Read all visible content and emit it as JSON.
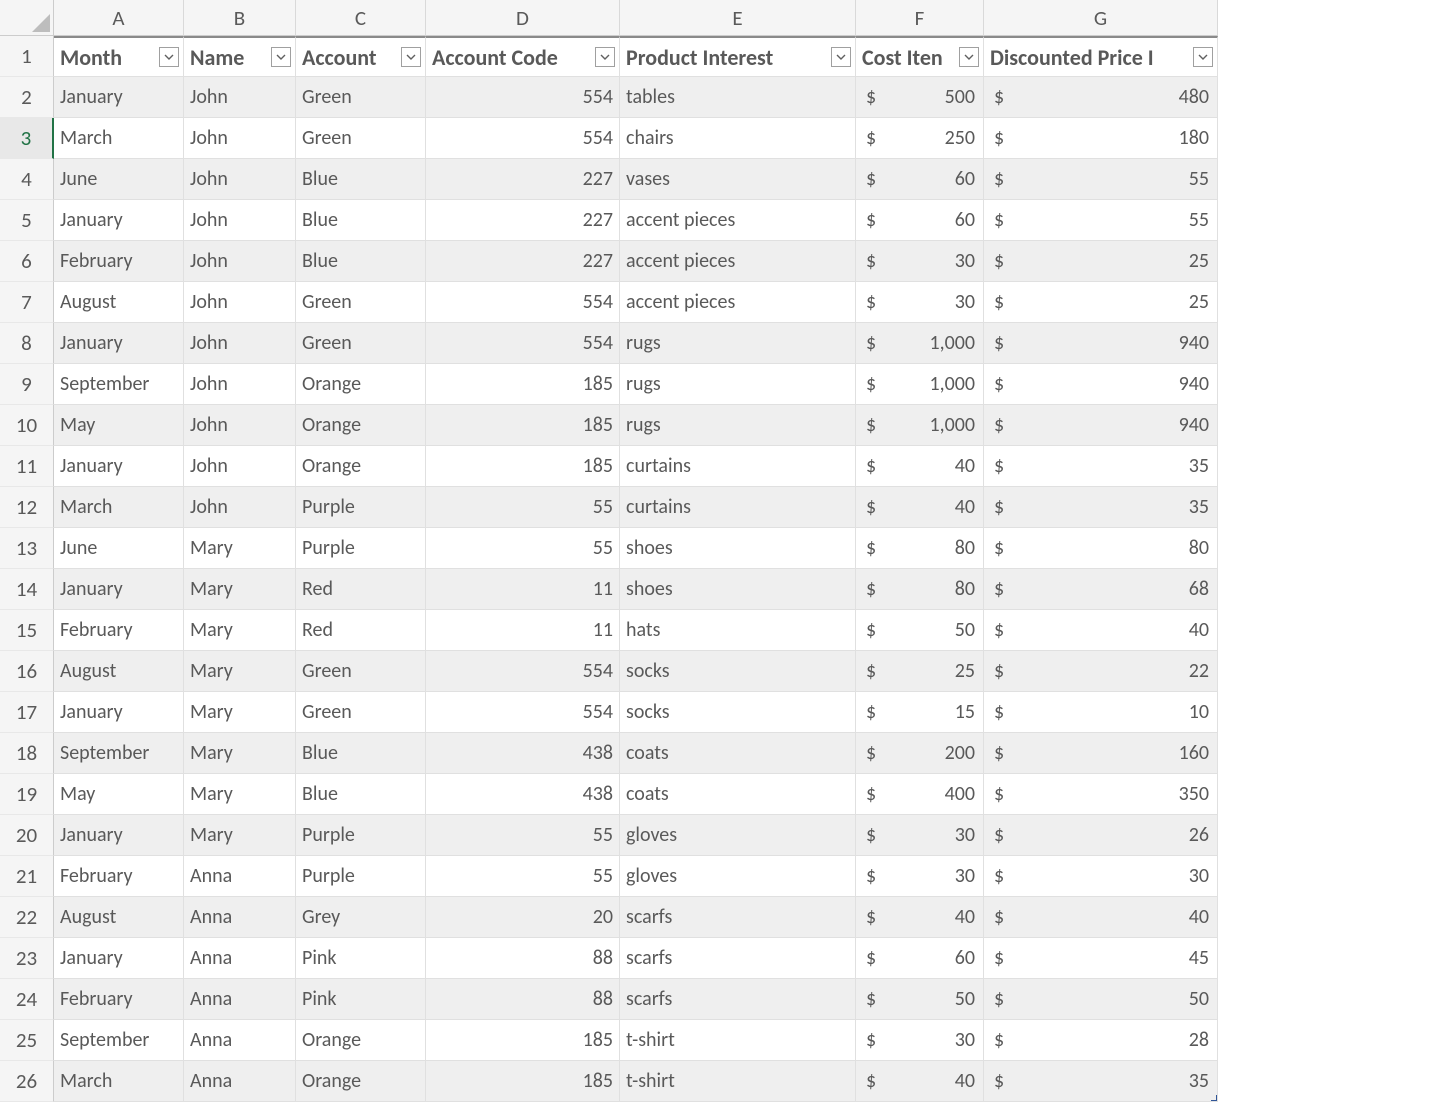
{
  "columns": [
    "A",
    "B",
    "C",
    "D",
    "E",
    "F",
    "G"
  ],
  "headers": {
    "A": "Month",
    "B": "Name",
    "C": "Account",
    "D": "Account Code",
    "E": "Product Interest",
    "F": "Cost Iten",
    "G": "Discounted Price I"
  },
  "currency_symbol": "$",
  "selected_row": 3,
  "rows": [
    {
      "n": 1
    },
    {
      "n": 2,
      "month": "January",
      "name": "John",
      "account": "Green",
      "code": "554",
      "product": "tables",
      "cost": "500",
      "disc": "480"
    },
    {
      "n": 3,
      "month": "March",
      "name": "John",
      "account": "Green",
      "code": "554",
      "product": "chairs",
      "cost": "250",
      "disc": "180"
    },
    {
      "n": 4,
      "month": "June",
      "name": "John",
      "account": "Blue",
      "code": "227",
      "product": "vases",
      "cost": "60",
      "disc": "55"
    },
    {
      "n": 5,
      "month": "January",
      "name": "John",
      "account": "Blue",
      "code": "227",
      "product": "accent pieces",
      "cost": "60",
      "disc": "55"
    },
    {
      "n": 6,
      "month": "February",
      "name": "John",
      "account": "Blue",
      "code": "227",
      "product": "accent pieces",
      "cost": "30",
      "disc": "25"
    },
    {
      "n": 7,
      "month": "August",
      "name": "John",
      "account": "Green",
      "code": "554",
      "product": "accent pieces",
      "cost": "30",
      "disc": "25"
    },
    {
      "n": 8,
      "month": "January",
      "name": "John",
      "account": "Green",
      "code": "554",
      "product": "rugs",
      "cost": "1,000",
      "disc": "940"
    },
    {
      "n": 9,
      "month": "September",
      "name": "John",
      "account": "Orange",
      "code": "185",
      "product": "rugs",
      "cost": "1,000",
      "disc": "940"
    },
    {
      "n": 10,
      "month": "May",
      "name": "John",
      "account": "Orange",
      "code": "185",
      "product": "rugs",
      "cost": "1,000",
      "disc": "940"
    },
    {
      "n": 11,
      "month": "January",
      "name": "John",
      "account": "Orange",
      "code": "185",
      "product": "curtains",
      "cost": "40",
      "disc": "35"
    },
    {
      "n": 12,
      "month": "March",
      "name": "John",
      "account": "Purple",
      "code": "55",
      "product": "curtains",
      "cost": "40",
      "disc": "35"
    },
    {
      "n": 13,
      "month": "June",
      "name": "Mary",
      "account": "Purple",
      "code": "55",
      "product": "shoes",
      "cost": "80",
      "disc": "80"
    },
    {
      "n": 14,
      "month": "January",
      "name": "Mary",
      "account": "Red",
      "code": "11",
      "product": "shoes",
      "cost": "80",
      "disc": "68"
    },
    {
      "n": 15,
      "month": "February",
      "name": "Mary",
      "account": "Red",
      "code": "11",
      "product": "hats",
      "cost": "50",
      "disc": "40"
    },
    {
      "n": 16,
      "month": "August",
      "name": "Mary",
      "account": "Green",
      "code": "554",
      "product": "socks",
      "cost": "25",
      "disc": "22"
    },
    {
      "n": 17,
      "month": "January",
      "name": "Mary",
      "account": "Green",
      "code": "554",
      "product": "socks",
      "cost": "15",
      "disc": "10"
    },
    {
      "n": 18,
      "month": "September",
      "name": "Mary",
      "account": "Blue",
      "code": "438",
      "product": "coats",
      "cost": "200",
      "disc": "160"
    },
    {
      "n": 19,
      "month": "May",
      "name": "Mary",
      "account": "Blue",
      "code": "438",
      "product": "coats",
      "cost": "400",
      "disc": "350"
    },
    {
      "n": 20,
      "month": "January",
      "name": "Mary",
      "account": "Purple",
      "code": "55",
      "product": "gloves",
      "cost": "30",
      "disc": "26"
    },
    {
      "n": 21,
      "month": "February",
      "name": "Anna",
      "account": "Purple",
      "code": "55",
      "product": "gloves",
      "cost": "30",
      "disc": "30"
    },
    {
      "n": 22,
      "month": "August",
      "name": "Anna",
      "account": "Grey",
      "code": "20",
      "product": "scarfs",
      "cost": "40",
      "disc": "40"
    },
    {
      "n": 23,
      "month": "January",
      "name": "Anna",
      "account": "Pink",
      "code": "88",
      "product": "scarfs",
      "cost": "60",
      "disc": "45"
    },
    {
      "n": 24,
      "month": "February",
      "name": "Anna",
      "account": "Pink",
      "code": "88",
      "product": "scarfs",
      "cost": "50",
      "disc": "50"
    },
    {
      "n": 25,
      "month": "September",
      "name": "Anna",
      "account": "Orange",
      "code": "185",
      "product": "t-shirt",
      "cost": "30",
      "disc": "28"
    },
    {
      "n": 26,
      "month": "March",
      "name": "Anna",
      "account": "Orange",
      "code": "185",
      "product": "t-shirt",
      "cost": "40",
      "disc": "35"
    }
  ]
}
